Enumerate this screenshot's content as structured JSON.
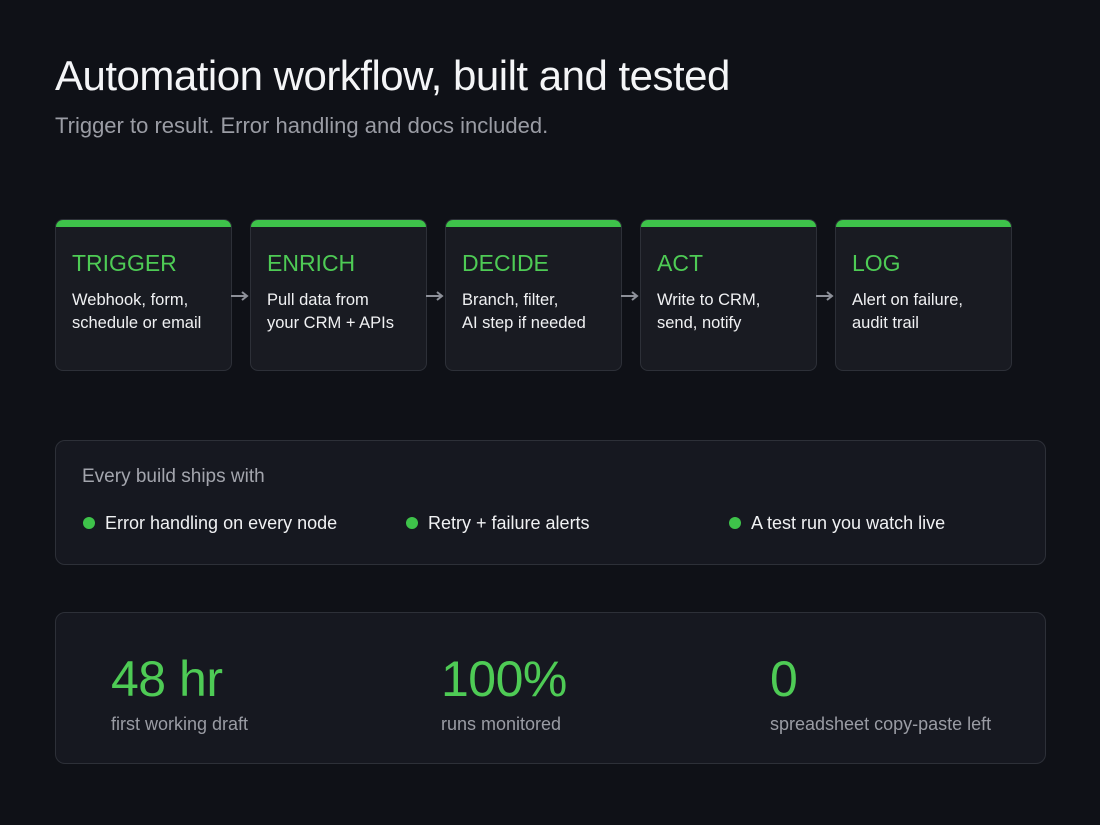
{
  "header": {
    "title": "Automation workflow, built and tested",
    "subtitle": "Trigger to result. Error handling and docs included."
  },
  "colors": {
    "accent": "#3ec24a",
    "background": "#0f1117",
    "card": "#191b22",
    "border": "#2d3038"
  },
  "steps": [
    {
      "title": "TRIGGER",
      "desc": "Webhook, form,\nschedule or email"
    },
    {
      "title": "ENRICH",
      "desc": "Pull data from\nyour CRM + APIs"
    },
    {
      "title": "DECIDE",
      "desc": "Branch, filter,\nAI step if needed"
    },
    {
      "title": "ACT",
      "desc": "Write to CRM,\nsend, notify"
    },
    {
      "title": "LOG",
      "desc": "Alert on failure,\naudit trail"
    }
  ],
  "connector_icon": "arrow-right-icon",
  "features": {
    "heading": "Every build ships with",
    "items": [
      "Error handling on every node",
      "Retry + failure alerts",
      "A test run you watch live"
    ]
  },
  "stats": [
    {
      "value": "48 hr",
      "label": "first working draft"
    },
    {
      "value": "100%",
      "label": "runs monitored"
    },
    {
      "value": "0",
      "label": "spreadsheet copy-paste left"
    }
  ]
}
